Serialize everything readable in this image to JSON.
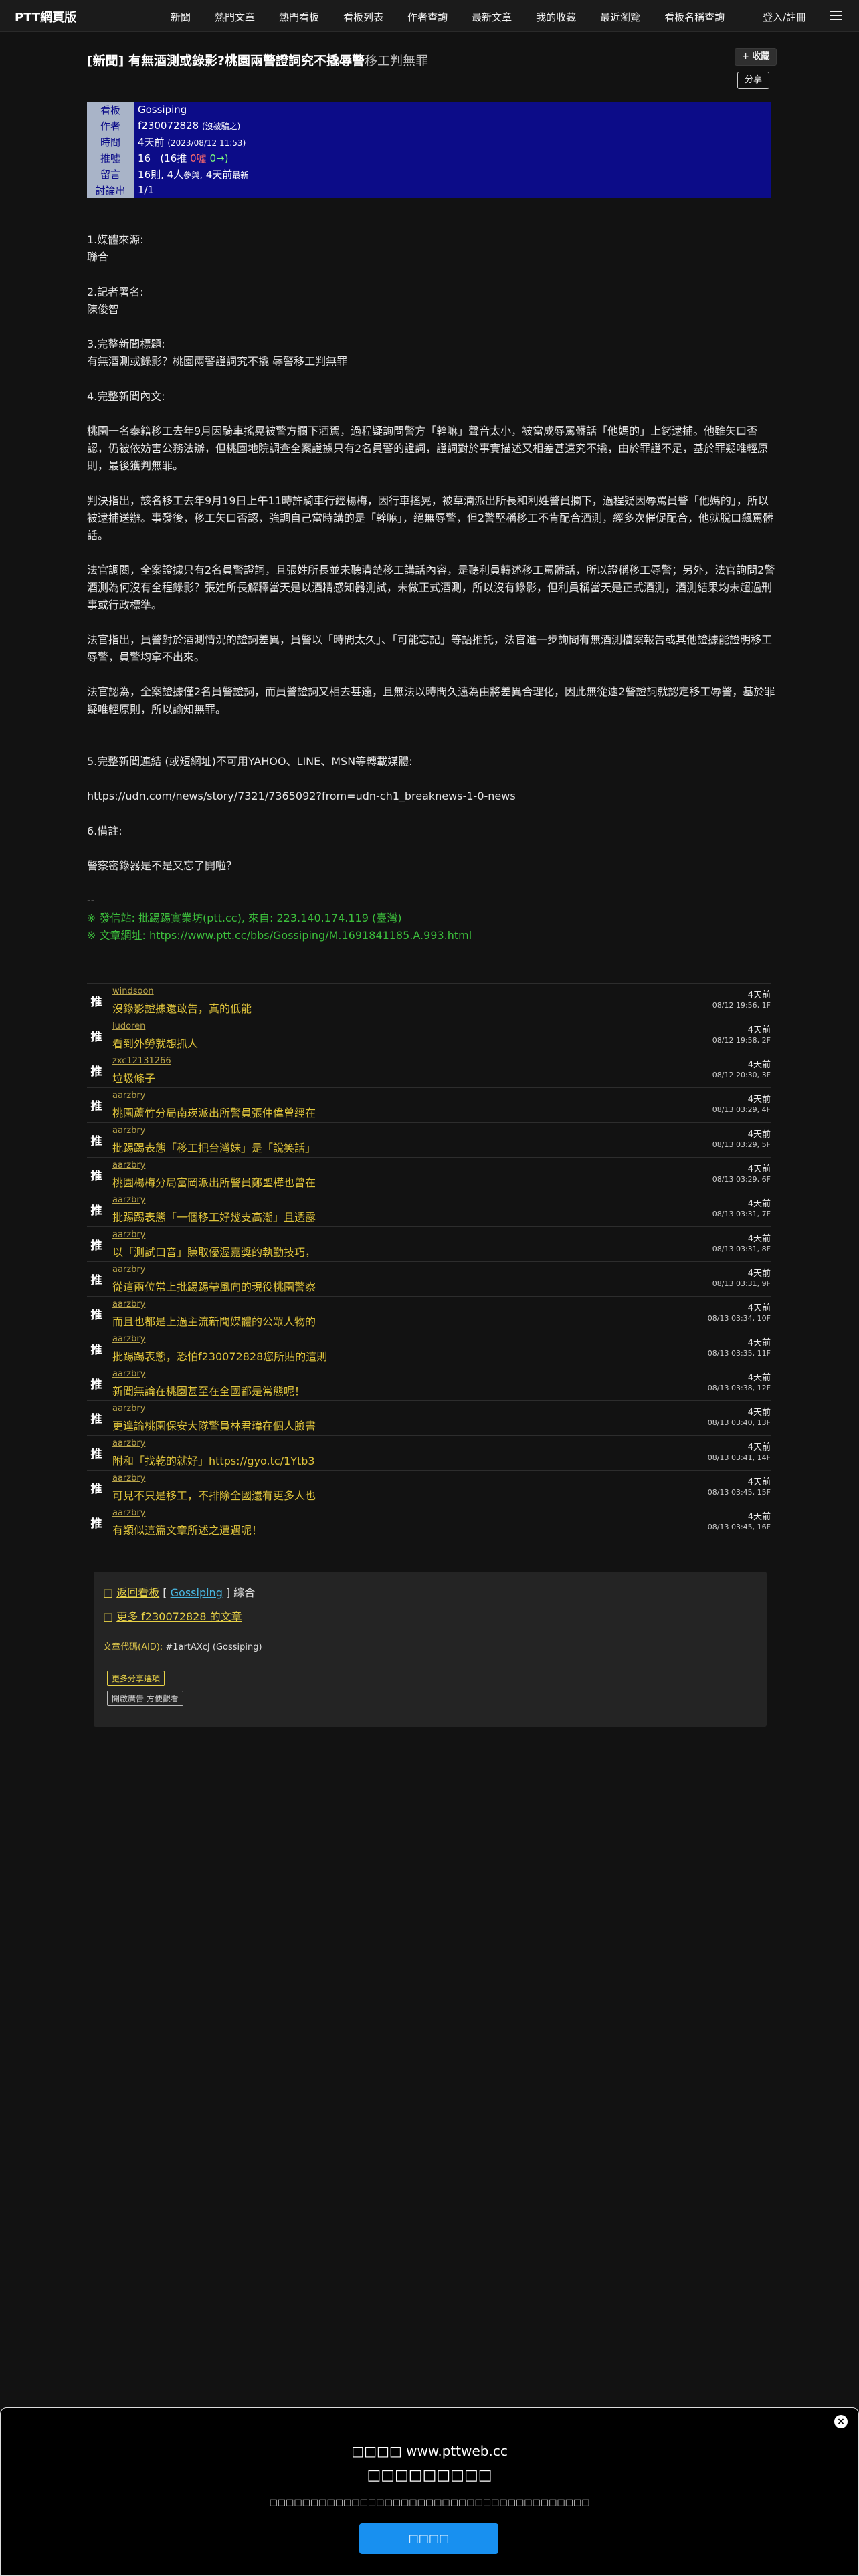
{
  "nav": {
    "brand": "PTT網頁版",
    "links": [
      "新聞",
      "熱門文章",
      "熱門看板",
      "看板列表",
      "作者查詢",
      "最新文章",
      "我的收藏",
      "最近瀏覽",
      "看板名稱查詢"
    ],
    "login": "登入/註冊"
  },
  "post": {
    "title_main": "[新聞] 有無酒測或錄影?桃園兩警證詞究不撬辱警",
    "title_dim": "移工判無罪",
    "fav_label": "+ 收藏",
    "share_label": "分享"
  },
  "meta": {
    "rows": [
      {
        "k": "看板",
        "v": "Gossiping"
      },
      {
        "k": "作者",
        "v": "f230072828",
        "v2": "(沒被騙之)"
      },
      {
        "k": "時間",
        "v": "4天前",
        "v2": "(2023/08/12 11:53)"
      },
      {
        "k": "推噓",
        "v": "16",
        "v2": "(16推",
        "v3": "0噓",
        "v4": "0→)"
      },
      {
        "k": "留言",
        "v": "16則, 4人",
        "v2": "參與",
        "v3": ", 4天前",
        "v4": "最新"
      },
      {
        "k": "討論串",
        "v": "1/1"
      }
    ]
  },
  "content": {
    "p1": "1.媒體來源:",
    "p1b": "聯合",
    "p2": "2.記者署名:",
    "p2b": "陳俊智",
    "p3": "3.完整新聞標題:",
    "p3b": "有無酒測或錄影？桃園兩警證詞究不撬 辱警移工判無罪",
    "p4": "4.完整新聞內文:",
    "p5": "桃園一名泰籍移工去年9月因騎車搖晃被警方攔下酒駕，過程疑詢問警方「幹嘛」聲音太小，被當成辱罵髒話「他媽的」上銬逮捕。他雖矢口否認，仍被依妨害公務法辦，但桃園地院調查全案證據只有2名員警的證詞，證詞對於事實描述又相差甚遠究不撬，由於罪證不足，基於罪疑唯輕原則，最後獲判無罪。",
    "p6": "判決指出，該名移工去年9月19日上午11時許騎車行經楊梅，因行車搖晃，被草湳派出所長和利姓警員攔下，過程疑因辱罵員警「他媽的」，所以被逮捕送辦。事發後，移工矢口否認，強調自己當時講的是「幹嘛」，絕無辱警，但2警堅稱移工不肯配合酒測，經多次催促配合，他就脫口飆罵髒話。",
    "p7": "法官調閱，全案證據只有2名員警證詞，且張姓所長並未聽清楚移工講話內容，是聽利員轉述移工罵髒話，所以證稱移工辱警；另外，法官詢問2警酒測為何沒有全程錄影？張姓所長解釋當天是以酒精感知器測試，未做正式酒測，所以沒有錄影，但利員稱當天是正式酒測，酒測結果均未超過刑事或行政標準。",
    "p8": "法官指出，員警對於酒測情況的證詞差異，員警以「時間太久」、「可能忘記」等語推託，法官進一步詢問有無酒測檔案報告或其他證據能證明移工辱警，員警均拿不出來。",
    "p9": "法官認為，全案證據僅2名員警證詞，而員警證詞又相去甚遠，且無法以時間久遠為由將差異合理化，因此無從遽2警證詞就認定移工辱警，基於罪疑唯輕原則，所以諭知無罪。",
    "p10": "5.完整新聞連結 (或短網址)不可用YAHOO、LINE、MSN等轉載媒體:",
    "p11": "https://udn.com/news/story/7321/7365092?from=udn-ch1_breaknews-1-0-news",
    "p12": "6.備註:",
    "p13": "警察密錄器是不是又忘了開啦？",
    "sig0": "--",
    "sig1": "※ 發信站: 批踢踢實業坊(ptt.cc), 來自: 223.140.174.119 (臺灣)",
    "sig2": "※ 文章網址: https://www.ptt.cc/bbs/Gossiping/M.1691841185.A.993.html"
  },
  "pushes": [
    {
      "tag": "推",
      "uid": "windsoon",
      "text": "沒錄影證據還敢告，真的低能",
      "t1": "4天前",
      "t2": "08/12 19:56, 1F"
    },
    {
      "tag": "推",
      "uid": "ludoren",
      "text": "看到外勞就想抓人",
      "t1": "4天前",
      "t2": "08/12 19:58, 2F"
    },
    {
      "tag": "推",
      "uid": "zxc12131266",
      "text": "垃圾條子",
      "t1": "4天前",
      "t2": "08/12 20:30, 3F"
    },
    {
      "tag": "推",
      "uid": "aarzbry",
      "text": "桃園蘆竹分局南崁派出所警員張仲偉曾經在",
      "t1": "4天前",
      "t2": "08/13 03:29, 4F"
    },
    {
      "tag": "推",
      "uid": "aarzbry",
      "text": "批踢踢表態「移工把台灣妹」是「說笑話」",
      "t1": "4天前",
      "t2": "08/13 03:29, 5F"
    },
    {
      "tag": "推",
      "uid": "aarzbry",
      "text": "桃園楊梅分局富岡派出所警員鄭聖樺也曾在",
      "t1": "4天前",
      "t2": "08/13 03:29, 6F"
    },
    {
      "tag": "推",
      "uid": "aarzbry",
      "text": "批踢踢表態「一個移工好幾支高潮」且透露",
      "t1": "4天前",
      "t2": "08/13 03:31, 7F"
    },
    {
      "tag": "推",
      "uid": "aarzbry",
      "text": "以「測試口音」賺取優渥嘉獎的執勤技巧，",
      "t1": "4天前",
      "t2": "08/13 03:31, 8F"
    },
    {
      "tag": "推",
      "uid": "aarzbry",
      "text": "從這兩位常上批踢踢帶風向的現役桃園警察",
      "t1": "4天前",
      "t2": "08/13 03:31, 9F"
    },
    {
      "tag": "推",
      "uid": "aarzbry",
      "text": "而且也都是上過主流新聞媒體的公眾人物的",
      "t1": "4天前",
      "t2": "08/13 03:34, 10F"
    },
    {
      "tag": "推",
      "uid": "aarzbry",
      "text": "批踢踢表態，恐怕f230072828您所貼的這則",
      "t1": "4天前",
      "t2": "08/13 03:35, 11F"
    },
    {
      "tag": "推",
      "uid": "aarzbry",
      "text": "新聞無論在桃園甚至在全國都是常態呢！",
      "t1": "4天前",
      "t2": "08/13 03:38, 12F"
    },
    {
      "tag": "推",
      "uid": "aarzbry",
      "text": "更遑論桃園保安大隊警員林君瑋在個人臉書",
      "t1": "4天前",
      "t2": "08/13 03:40, 13F"
    },
    {
      "tag": "推",
      "uid": "aarzbry",
      "text": "附和「找乾的就好」https://gyo.tc/1Ytb3",
      "t1": "4天前",
      "t2": "08/13 03:41, 14F"
    },
    {
      "tag": "推",
      "uid": "aarzbry",
      "text": "可見不只是移工，不排除全國還有更多人也",
      "t1": "4天前",
      "t2": "08/13 03:45, 15F"
    },
    {
      "tag": "推",
      "uid": "aarzbry",
      "text": "有類似這篇文章所述之遭遇呢！",
      "t1": "4天前",
      "t2": "08/13 03:45, 16F"
    }
  ],
  "footer": {
    "back_prefix": "□ ",
    "back": "返回看板",
    "bracket_open": " [ ",
    "board": "Gossiping",
    "bracket_close": " ] ",
    "section": "綜合",
    "more_prefix": "□ ",
    "more": "更多 f230072828 的文章",
    "aid_label": "文章代碼(AID): ",
    "aid_value": "#1artAXcJ (Gossiping)",
    "btn1": "更多分享選項",
    "btn2": "開啟廣告 方便觀看"
  },
  "banner": {
    "close": "×",
    "site": "□□□□ www.pttweb.cc",
    "head": "□□□□□□□□□",
    "desc": "□□□□□□□□□□□□□□□□□□□□□□□□□□□□□□□□□□□□□□□",
    "button": "□□□□"
  }
}
